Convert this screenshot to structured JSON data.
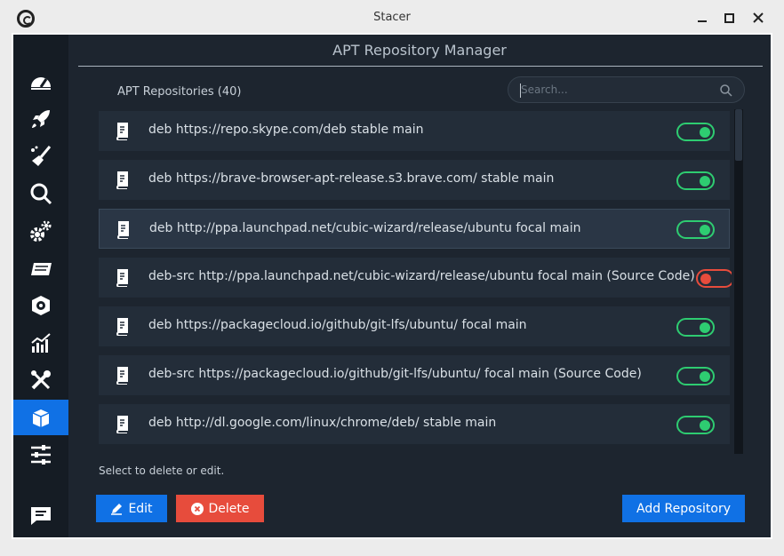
{
  "window": {
    "title": "Stacer"
  },
  "page": {
    "title": "APT Repository Manager"
  },
  "repositories": {
    "count_label": "APT Repositories (40)",
    "search_placeholder": "Search...",
    "items": [
      {
        "source": "deb https://repo.skype.com/deb stable main",
        "enabled": true
      },
      {
        "source": "deb https://brave-browser-apt-release.s3.brave.com/ stable main",
        "enabled": true
      },
      {
        "source": "deb http://ppa.launchpad.net/cubic-wizard/release/ubuntu focal main",
        "enabled": true,
        "selected": true
      },
      {
        "source": "deb-src http://ppa.launchpad.net/cubic-wizard/release/ubuntu focal main (Source Code)",
        "enabled": false
      },
      {
        "source": "deb https://packagecloud.io/github/git-lfs/ubuntu/ focal main",
        "enabled": true
      },
      {
        "source": "deb-src https://packagecloud.io/github/git-lfs/ubuntu/ focal main (Source Code)",
        "enabled": true
      },
      {
        "source": "deb http://dl.google.com/linux/chrome/deb/ stable main",
        "enabled": true
      }
    ],
    "hint": "Select to delete or edit."
  },
  "actions": {
    "edit_label": "Edit",
    "delete_label": "Delete",
    "add_label": "Add Repository"
  },
  "sidebar": {
    "items": [
      {
        "icon": "dashboard-icon"
      },
      {
        "icon": "rocket-icon"
      },
      {
        "icon": "broom-icon"
      },
      {
        "icon": "search-icon"
      },
      {
        "icon": "gears-icon"
      },
      {
        "icon": "uninstaller-icon"
      },
      {
        "icon": "disk-icon"
      },
      {
        "icon": "chart-icon"
      },
      {
        "icon": "tools-icon"
      },
      {
        "icon": "package-icon",
        "active": true
      },
      {
        "icon": "settings-sliders-icon"
      },
      {
        "icon": "feedback-icon"
      }
    ]
  },
  "colors": {
    "accent": "#1071e5",
    "danger": "#e74c3c",
    "toggle_on": "#2ecc71",
    "panel": "#1d252f",
    "sidebar": "#151c24"
  }
}
